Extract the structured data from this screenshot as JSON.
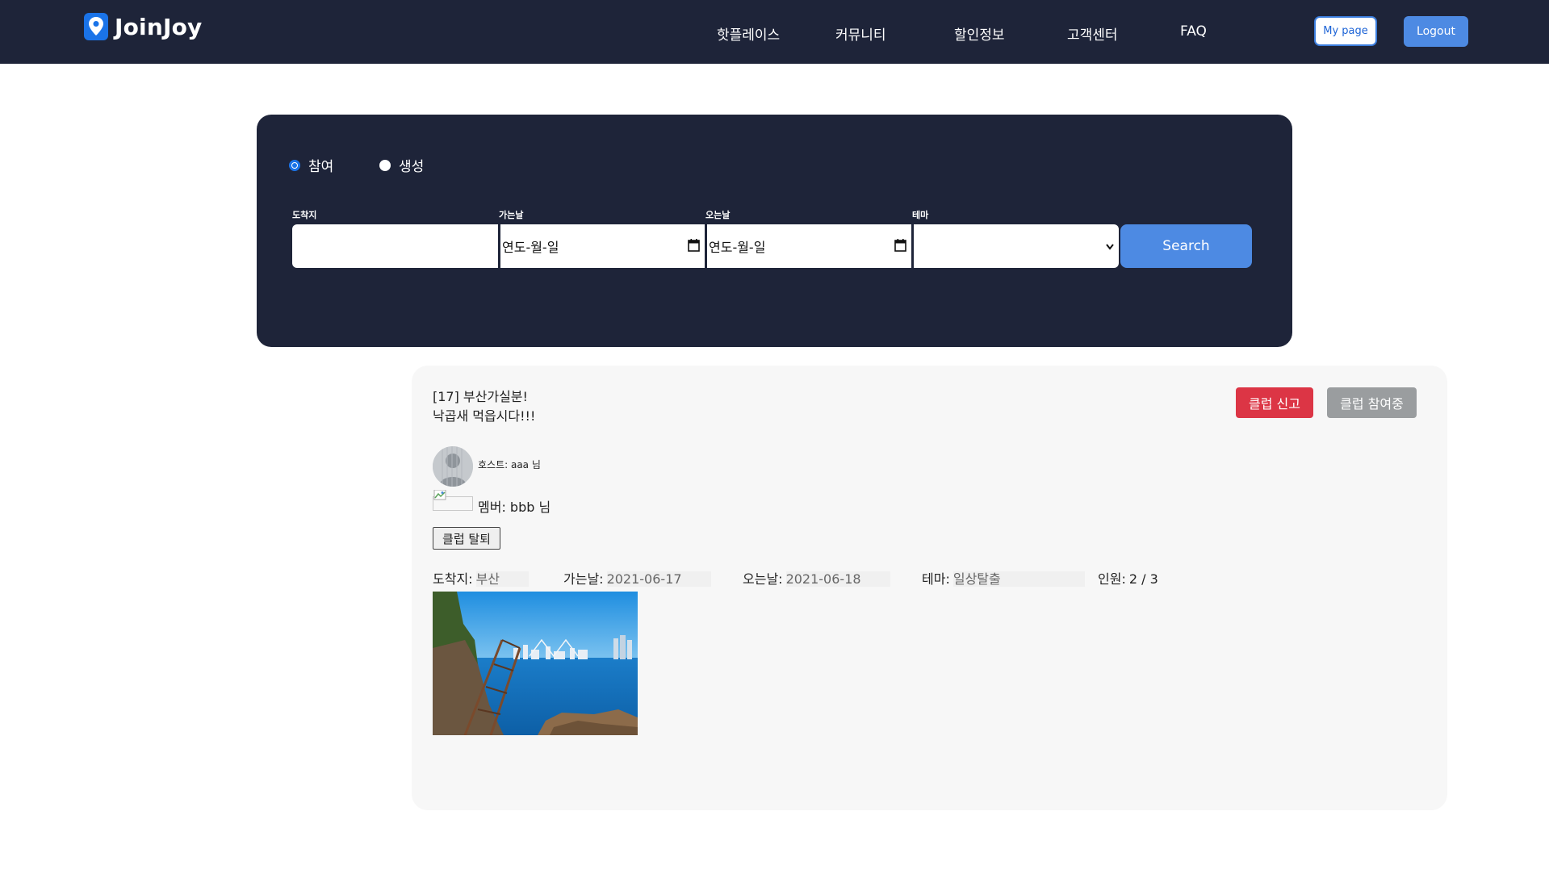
{
  "header": {
    "brand": "JoinJoy",
    "nav": [
      "핫플레이스",
      "커뮤니티",
      "할인정보",
      "고객센터",
      "FAQ"
    ],
    "mypage_label": "My page",
    "logout_label": "Logout"
  },
  "search": {
    "radio_join": "참여",
    "radio_create": "생성",
    "selected_mode": "참여",
    "labels": {
      "destination": "도착지",
      "depart": "가는날",
      "return": "오는날",
      "theme": "테마"
    },
    "destination_value": "",
    "depart_value": "연도-월-일",
    "return_value": "연도-월-일",
    "theme_value": "",
    "button_label": "Search"
  },
  "club": {
    "title_line1": "[17] 부산가실분!",
    "title_line2": "낙곱새 먹읍시다!!!",
    "report_label": "클럽 신고",
    "joined_label": "클럽 참여중",
    "host_text": "호스트: aaa 님",
    "member_text": "멤버: bbb 님",
    "leave_label": "클럽 탈퇴",
    "destination_key": "도착지:",
    "destination_val": "부산",
    "depart_key": "가는날:",
    "depart_val": "2021-06-17",
    "return_key": "오는날:",
    "return_val": "2021-06-18",
    "theme_key": "테마:",
    "theme_val": "일상탈출",
    "people_key": "인원:",
    "people_val": "2 / 3"
  },
  "colors": {
    "navy": "#1e2439",
    "accent_blue": "#4d8ae3",
    "danger": "#dc3545",
    "muted_gray": "#9a9d9f"
  }
}
